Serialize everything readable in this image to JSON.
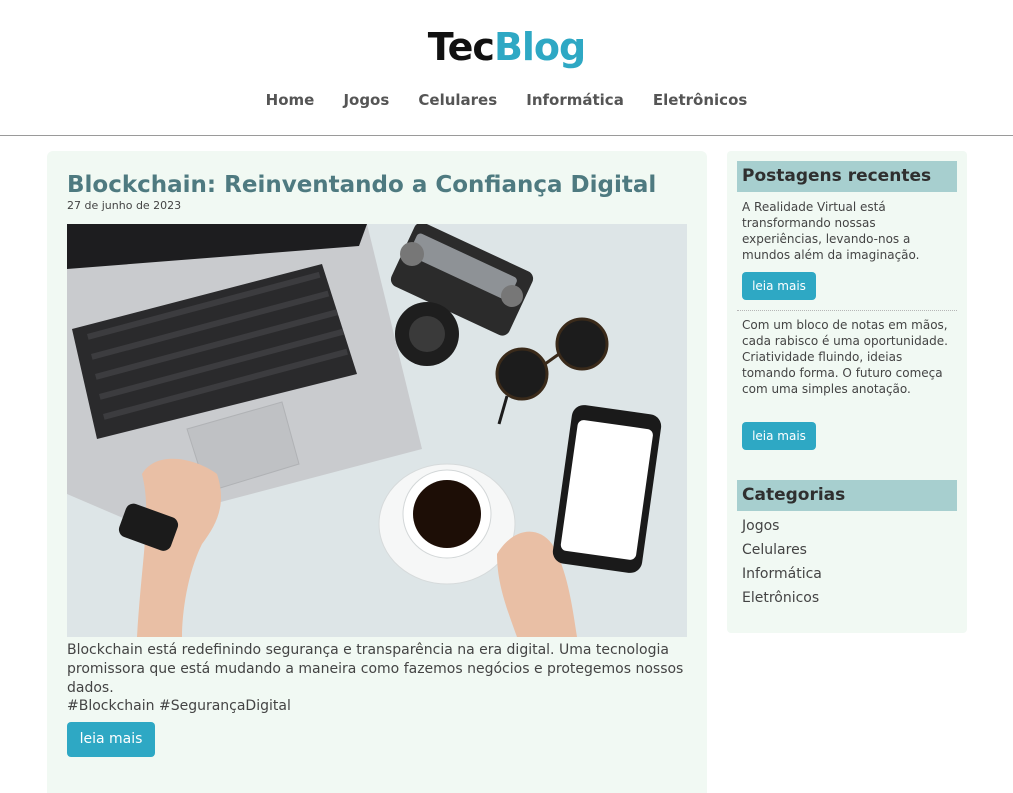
{
  "header": {
    "logo_part1": "Tec",
    "logo_part2": "Blog",
    "nav": [
      "Home",
      "Jogos",
      "Celulares",
      "Informática",
      "Eletrônicos"
    ]
  },
  "post": {
    "title": "Blockchain: Reinventando a Confiança Digital",
    "date": "27 de junho de 2023",
    "text": "Blockchain está redefinindo segurança e transparência na era digital. Uma tecnologia promissora que está mudando a maneira como fazemos negócios e protegemos nossos dados.",
    "tags": "#Blockchain #SegurançaDigital",
    "button_label": "leia mais"
  },
  "sidebar": {
    "recent_heading": "Postagens recentes",
    "recent": [
      {
        "text": "A Realidade Virtual está transformando nossas experiências, levando-nos a mundos além da imaginação.",
        "button_label": "leia mais"
      },
      {
        "text": "Com um bloco de notas em mãos, cada rabisco é uma oportunidade. Criatividade fluindo, ideias tomando forma. O futuro começa com uma simples anotação.",
        "button_label": "leia mais"
      }
    ],
    "categories_heading": "Categorias",
    "categories": [
      "Jogos",
      "Celulares",
      "Informática",
      "Eletrônicos"
    ]
  },
  "colors": {
    "accent": "#2ea8c4",
    "title": "#4e7a80",
    "panel_bg": "#f1f9f3",
    "sidebar_heading_bg": "#a7cfcf"
  }
}
